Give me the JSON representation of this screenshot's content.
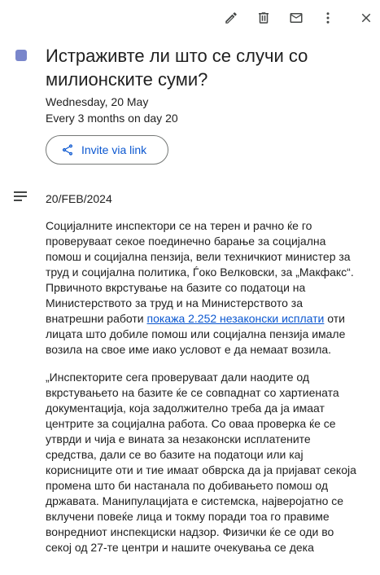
{
  "toolbar": {
    "icons": [
      "pencil-icon",
      "trash-icon",
      "mail-icon",
      "more-vert-icon",
      "close-icon"
    ]
  },
  "event": {
    "color": "#7986cb",
    "title": "Истраживте ли што се случи со милионските суми?",
    "date": "Wednesday, 20 May",
    "recurrence": "Every 3 months on day 20",
    "invite_label": "Invite via link",
    "invite_icon": "share-icon"
  },
  "description": {
    "icon": "notes-icon",
    "dateline": "20/FEB/2024",
    "p1_before": "Социјалните инспектори се на терен и рачно ќе го проверуваат секое поединечно барање за социјална помош и социјална пензија, вели техничкиот министер за труд и социјална политика, Ѓоко Велковски, за „Макфакс“. Првичното вкрстување на базите со податоци на Министерството за труд и на Министерството за внатрешни работи ",
    "p1_link": "покажа 2.252 незаконски исплати",
    "p1_after": " оти лицата што добиле помош или социјална пензија имале возила на свое име иако условот е да немаат возила.",
    "p2": "„Инспекторите сега проверуваат дали наодите од вкрстувањето на базите ќе се совпаднат со хартиената документација, која задолжително треба да ја имаат центрите за социјална работа. Со оваа проверка ќе се утврди и чија е вината за незаконски исплатените средства, дали се во базите на податоци или кај корисниците оти и тие имаат обврска да ја пријават секоја промена што би настанала по добивањето помош од државата. Манипулацијата е системска, најверојатно се вклучени повеќе лица и токму поради тоа го правиме вонредниот инспекциски надзор. Физички ќе се оди во секој од 27-те центри и нашите очекувања се дека"
  }
}
